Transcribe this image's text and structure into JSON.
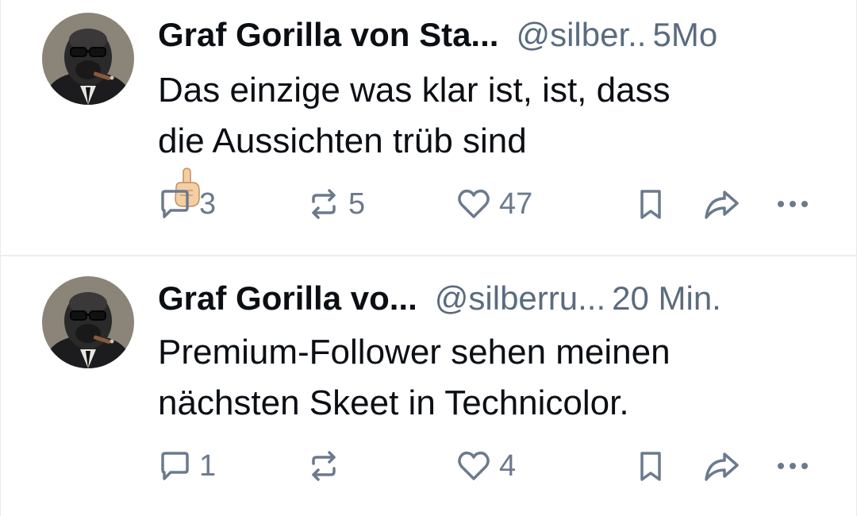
{
  "posts": [
    {
      "author_name": "Graf Gorilla von Sta...",
      "handle": "@silber..",
      "time": "5Mo",
      "text_lines": [
        "Das einzige was klar ist, ist, dass",
        "die Aussichten trüb sind"
      ],
      "emoji": "pointing-up-emoji",
      "reply_count": "3",
      "repost_count": "5",
      "like_count": "47"
    },
    {
      "author_name": "Graf Gorilla vo...",
      "handle": "@silberru...",
      "time": "20 Min.",
      "text_lines": [
        "Premium-Follower sehen meinen",
        "nächsten Skeet in Technicolor."
      ],
      "reply_count": "1",
      "repost_count": "",
      "like_count": "4"
    }
  ],
  "icons": {
    "reply": "reply-bubble-icon",
    "repost": "repost-arrows-icon",
    "like": "heart-icon",
    "bookmark": "bookmark-icon",
    "share": "share-arrow-icon",
    "more": "more-dots-icon"
  },
  "colors": {
    "text": "#0b0f14",
    "muted": "#5b6b7f",
    "icon": "#6b7a8d",
    "divider": "#e9eef3"
  }
}
